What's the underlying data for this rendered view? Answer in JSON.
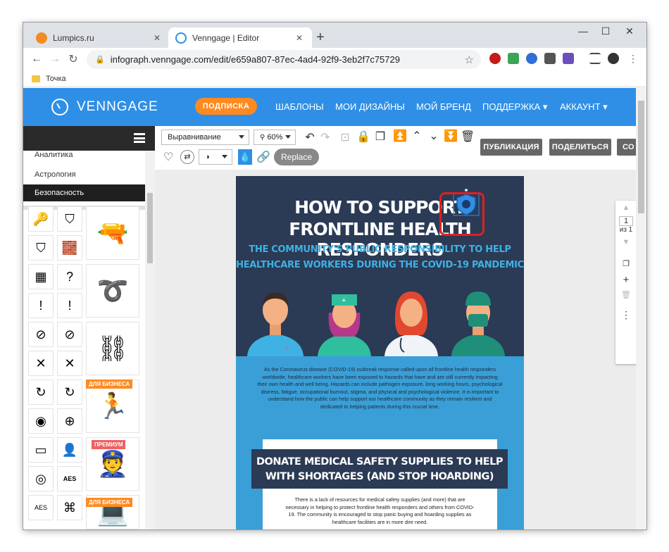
{
  "browser": {
    "tabs": [
      {
        "title": "Lumpics.ru",
        "favicon_color": "#f28b20"
      },
      {
        "title": "Venngage | Editor",
        "favicon_color": "#2f8fe6"
      }
    ],
    "close_label": "✕",
    "new_tab_label": "+",
    "url": "infograph.venngage.com/edit/e659a807-87ec-4ad4-92f9-3eb2f7c75729",
    "bookmark": "Точка"
  },
  "header": {
    "logo": "VENNGAGE",
    "subscribe": "ПОДПИСКА",
    "nav": [
      "ШАБЛОНЫ",
      "МОИ ДИЗАЙНЫ",
      "МОЙ БРЕНД",
      "ПОДДЕРЖКА ▾",
      "АККАУНТ ▾"
    ]
  },
  "sidebar": {
    "categories": [
      "Аналитика",
      "Астрология",
      "Безопасность"
    ],
    "selected": "Безопасность",
    "badges": {
      "business": "ДЛЯ БИЗНЕСА",
      "premium": "ПРЕМИУМ"
    },
    "icon_labels": {
      "aes": "AES"
    }
  },
  "editor_toolbar": {
    "align_select": "Выравнивание",
    "zoom_select": "60%",
    "replace": "Replace",
    "publish": "ПУБЛИКАЦИЯ",
    "share": "ПОДЕЛИТЬСЯ",
    "more": "СО"
  },
  "pagination": {
    "current": "1",
    "of": "из 1"
  },
  "infographic": {
    "title_line1": "HOW TO SUPPORT",
    "title_line2": "FRONTLINE HEALTH RESPONDERS",
    "subtitle_line1": "THE COMMUNITY'S PUBLIC RESPONSIBILITY TO HELP",
    "subtitle_line2": "HEALTHCARE WORKERS DURING THE COVID-19 PANDEMIC",
    "intro": "As the Coronavirus disease (COVID-19) outbreak response called upon all frontline health responders worldwide, healthcare workers have been exposed to hazards that have and are still currently impacting their own health and well being. Hazards can include pathogen exposure, long working hours, psychological distress, fatigue, occupational burnout, stigma, and physical and psychological violence. It is important to understand how the public can help support our healthcare community as they remain resilient and dedicated to helping patients during this crucial time.",
    "section_title_line1": "DONATE MEDICAL SAFETY SUPPLIES TO HELP",
    "section_title_line2": "WITH SHORTAGES (AND STOP HOARDING)",
    "section_text": "There is a lack of resources for medical safety supplies (and more) that are necessary in helping to protect frontline health responders and others from COVID-19. The community is encouraged to stop panic buying and hoarding supplies as healthcare facilities are in more dire need."
  },
  "colors": {
    "header_blue": "#2f8fe6",
    "subscribe_orange": "#ff8a1f",
    "doc_navy": "#2b3a55",
    "doc_blue": "#3a9fd6",
    "selection_red": "#e02020"
  }
}
